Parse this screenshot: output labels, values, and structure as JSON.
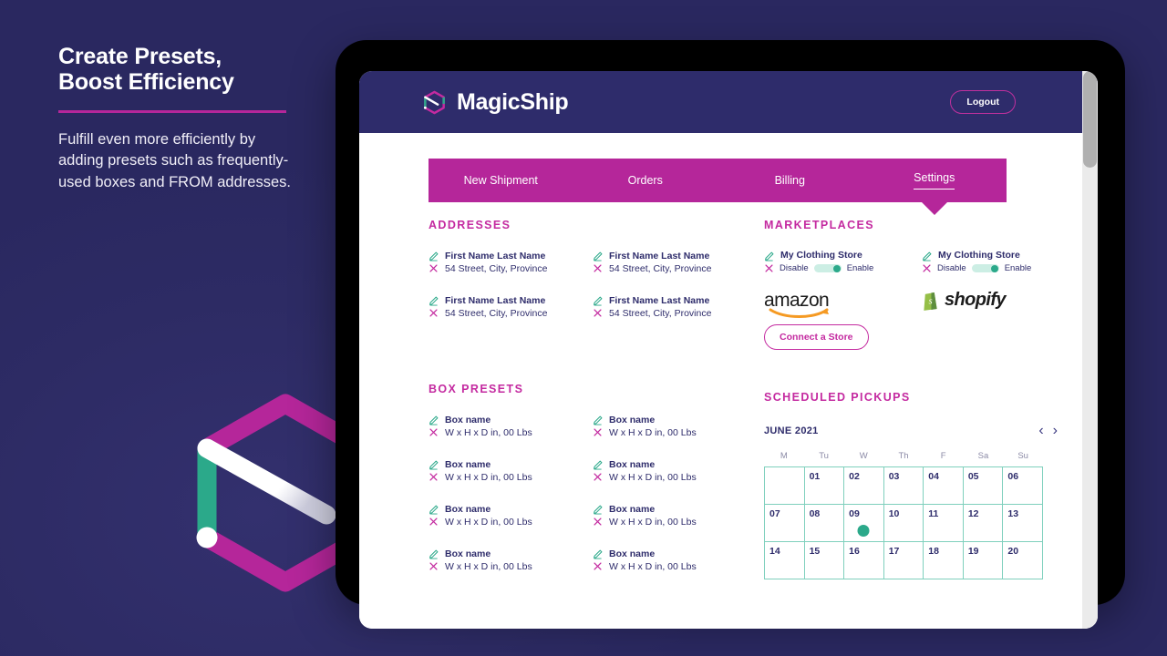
{
  "promo": {
    "title_line1": "Create Presets,",
    "title_line2": "Boost Efficiency",
    "body": "Fulfill even more efficiently by adding presets such as frequently-used boxes and FROM addresses."
  },
  "app": {
    "brand_name": "MagicShip",
    "logout_label": "Logout"
  },
  "nav": {
    "items": [
      {
        "label": "New Shipment",
        "active": false
      },
      {
        "label": "Orders",
        "active": false
      },
      {
        "label": "Billing",
        "active": false
      },
      {
        "label": "Settings",
        "active": true
      }
    ]
  },
  "addresses": {
    "title": "ADDRESSES",
    "items": [
      {
        "name": "First Name Last Name",
        "detail": "54 Street, City, Province"
      },
      {
        "name": "First Name Last Name",
        "detail": "54 Street, City, Province"
      },
      {
        "name": "First Name Last Name",
        "detail": "54 Street, City, Province"
      },
      {
        "name": "First Name Last Name",
        "detail": "54 Street, City, Province"
      }
    ]
  },
  "marketplaces": {
    "title": "MARKETPLACES",
    "connect_label": "Connect a Store",
    "stores": [
      {
        "name": "My Clothing Store",
        "disable_label": "Disable",
        "enable_label": "Enable",
        "toggle_state": "enabled",
        "logo": "amazon",
        "logo_text": "amazon"
      },
      {
        "name": "My Clothing Store",
        "disable_label": "Disable",
        "enable_label": "Enable",
        "toggle_state": "enabled",
        "logo": "shopify",
        "logo_text": "shopify"
      }
    ]
  },
  "box_presets": {
    "title": "BOX PRESETS",
    "items": [
      {
        "name": "Box name",
        "detail": "W x H x D in, 00 Lbs"
      },
      {
        "name": "Box name",
        "detail": "W x H x D in, 00 Lbs"
      },
      {
        "name": "Box name",
        "detail": "W x H x D in, 00 Lbs"
      },
      {
        "name": "Box name",
        "detail": "W x H x D in, 00 Lbs"
      },
      {
        "name": "Box name",
        "detail": "W x H x D in, 00 Lbs"
      },
      {
        "name": "Box name",
        "detail": "W x H x D in, 00 Lbs"
      },
      {
        "name": "Box name",
        "detail": "W x H x D in, 00 Lbs"
      },
      {
        "name": "Box name",
        "detail": "W x H x D in, 00 Lbs"
      }
    ]
  },
  "scheduled_pickups": {
    "title": "SCHEDULED PICKUPS",
    "month_label": "JUNE 2021",
    "prev_icon": "‹",
    "next_icon": "›",
    "day_names": [
      "M",
      "Tu",
      "W",
      "Th",
      "F",
      "Sa",
      "Su"
    ],
    "cells": [
      {
        "day": ""
      },
      {
        "day": "01"
      },
      {
        "day": "02"
      },
      {
        "day": "03"
      },
      {
        "day": "04"
      },
      {
        "day": "05"
      },
      {
        "day": "06"
      },
      {
        "day": "07"
      },
      {
        "day": "08"
      },
      {
        "day": "09",
        "dot": true
      },
      {
        "day": "10"
      },
      {
        "day": "11"
      },
      {
        "day": "12"
      },
      {
        "day": "13"
      },
      {
        "day": "14"
      },
      {
        "day": "15"
      },
      {
        "day": "16"
      },
      {
        "day": "17"
      },
      {
        "day": "18"
      },
      {
        "day": "19"
      },
      {
        "day": "20"
      }
    ]
  },
  "colors": {
    "background": "#2c2a63",
    "brand_navy": "#2e2c6b",
    "magenta": "#b5269a",
    "pink_accent": "#c42aa0",
    "teal": "#2ba98a",
    "teal_grid": "#7fd0bd"
  },
  "icons": {
    "edit": "pencil-icon",
    "delete": "close-x-icon"
  }
}
